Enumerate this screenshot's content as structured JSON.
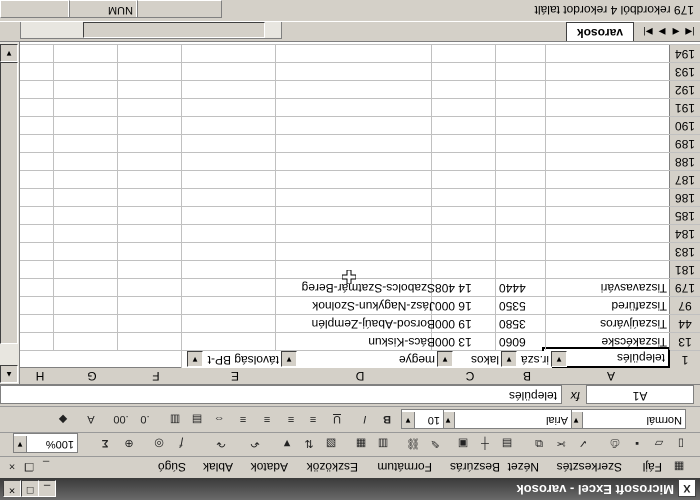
{
  "window": {
    "title": "Microsoft Excel - varosok",
    "app_icon": "X",
    "buttons": [
      "_",
      "□",
      "×"
    ]
  },
  "menu": [
    "Fájl",
    "Szerkesztés",
    "Nézet",
    "Beszúrás",
    "Formátum",
    "Eszközök",
    "Adatok",
    "Ablak",
    "Súgó"
  ],
  "standard_toolbar": {
    "zoom": "100%",
    "sum": "Σ"
  },
  "format_toolbar": {
    "style": "Normál",
    "font": "Arial",
    "size": "10"
  },
  "formula_bar": {
    "name_box": "A1",
    "fx": "fx",
    "content": "település"
  },
  "columns": [
    "A",
    "B",
    "C",
    "D",
    "E",
    "F",
    "G",
    "H"
  ],
  "header_row": {
    "num": "1",
    "cells": [
      "település",
      "ir.szá",
      "lakos",
      "megye",
      "távolság BP-t"
    ]
  },
  "rows": [
    {
      "num": "13",
      "cells": [
        "Tiszakécske",
        "6060",
        "13 000",
        "Bács-Kiskun",
        ""
      ]
    },
    {
      "num": "44",
      "cells": [
        "Tiszaújváros",
        "3580",
        "19 000",
        "Borsod-Abaúj-Zemplén",
        ""
      ]
    },
    {
      "num": "97",
      "cells": [
        "Tiszafüred",
        "5350",
        "16 000",
        "Jász-Nagykun-Szolnok",
        ""
      ]
    },
    {
      "num": "179",
      "cells": [
        "Tiszavasvári",
        "4440",
        "14 408",
        "Szabolcs-Szatmár-Bereg",
        ""
      ]
    },
    {
      "num": "181",
      "cells": [
        "",
        "",
        "",
        "",
        ""
      ]
    },
    {
      "num": "183",
      "cells": [
        "",
        "",
        "",
        "",
        ""
      ]
    },
    {
      "num": "184",
      "cells": [
        "",
        "",
        "",
        "",
        ""
      ]
    },
    {
      "num": "185",
      "cells": [
        "",
        "",
        "",
        "",
        ""
      ]
    },
    {
      "num": "186",
      "cells": [
        "",
        "",
        "",
        "",
        ""
      ]
    },
    {
      "num": "187",
      "cells": [
        "",
        "",
        "",
        "",
        ""
      ]
    },
    {
      "num": "188",
      "cells": [
        "",
        "",
        "",
        "",
        ""
      ]
    },
    {
      "num": "189",
      "cells": [
        "",
        "",
        "",
        "",
        ""
      ]
    },
    {
      "num": "190",
      "cells": [
        "",
        "",
        "",
        "",
        ""
      ]
    },
    {
      "num": "191",
      "cells": [
        "",
        "",
        "",
        "",
        ""
      ]
    },
    {
      "num": "192",
      "cells": [
        "",
        "",
        "",
        "",
        ""
      ]
    },
    {
      "num": "193",
      "cells": [
        "",
        "",
        "",
        "",
        ""
      ]
    },
    {
      "num": "194",
      "cells": [
        "",
        "",
        "",
        "",
        ""
      ]
    }
  ],
  "sheet_tab": "varosok",
  "status": {
    "text": "179 rekordból 4 rekordot talált",
    "num": "NUM"
  }
}
